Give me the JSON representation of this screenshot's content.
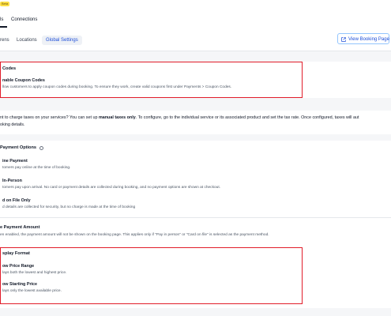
{
  "header": {
    "beta_badge": "Beta",
    "tab_active_fragment": "ls",
    "tab_connections": "Connections"
  },
  "subnav": {
    "tab_first_fragment": "rens",
    "tab_locations": "Locations",
    "tab_global_settings": "Global Settings",
    "view_booking_page": "View Booking Page"
  },
  "coupon": {
    "section_title": "Codes",
    "option_label": "nable Coupon Codes",
    "option_desc": "llow customers to apply coupon codes during booking. To ensure they work, create valid coupons first under Payments > Coupon Codes."
  },
  "taxes": {
    "line1_before": "nt to charge taxes on your services? You can set up ",
    "line1_bold": "manual taxes only",
    "line1_after": ". To configure, go to the individual service or its associated product and set the tax rate. Once configured, taxes will aut",
    "line2": "oking details."
  },
  "payment_options": {
    "title": "Payment Options",
    "options": [
      {
        "label": "ine Payment",
        "desc": "tomers pay online at the time of booking."
      },
      {
        "label": "In-Person",
        "desc": "tomers pay upon arrival. No card or payment details are collected during booking, and no payment options are shown at checkout."
      },
      {
        "label": "d on File Only",
        "desc": "d details are collected for security, but no charge is made at the time of booking"
      }
    ]
  },
  "payment_amount": {
    "title": "e Payment Amount",
    "desc": "en enabled, the payment amount will not be shown on the booking page. This applies only if \"Pay in person\" or \"Card on file\" is selected as the payment method."
  },
  "display_format": {
    "title": "splay Format",
    "options": [
      {
        "label": "ow Price Range",
        "desc": "lays both the lowest and highest price."
      },
      {
        "label": "ow Starting Price",
        "desc": "lays only the lowest available price."
      }
    ]
  },
  "colors": {
    "highlight_border": "#e11d2a",
    "accent_blue": "#1d4ed8",
    "beta_yellow": "#fde047"
  }
}
